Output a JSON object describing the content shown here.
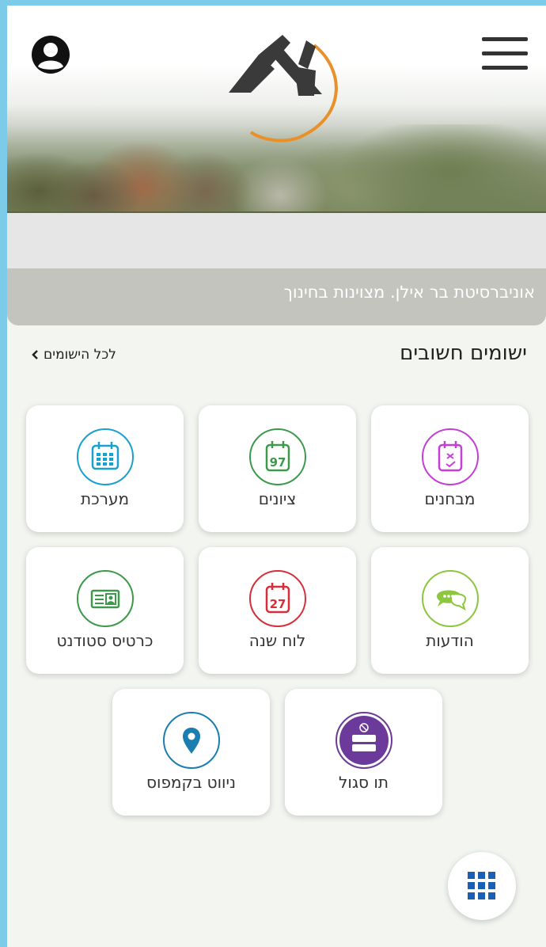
{
  "header": {
    "slogan": "אוניברסיטת בר אילן. מצוינות בחינוך"
  },
  "section": {
    "title": "ישומים חשובים",
    "all_link": "לכל הישומים"
  },
  "apps": [
    {
      "label": "מבחנים",
      "icon": "exam-icon",
      "color": "#c33fd6"
    },
    {
      "label": "ציונים",
      "icon": "grades-icon",
      "color": "#3d9a4a",
      "value": "97"
    },
    {
      "label": "מערכת",
      "icon": "schedule-icon",
      "color": "#1a9fcf"
    },
    {
      "label": "הודעות",
      "icon": "messages-icon",
      "color": "#8dc63f"
    },
    {
      "label": "לוח שנה",
      "icon": "calendar-icon",
      "color": "#d62f3a",
      "value": "27"
    },
    {
      "label": "כרטיס סטודנט",
      "icon": "student-card-icon",
      "color": "#3d9a4a"
    },
    {
      "label": "תו סגול",
      "icon": "purple-badge-icon",
      "color": "#6b3a9a"
    },
    {
      "label": "ניווט בקמפוס",
      "icon": "location-pin-icon",
      "color": "#1a7fb0"
    }
  ],
  "brand": {
    "accent": "#e8912a",
    "logo_color": "#333333"
  }
}
